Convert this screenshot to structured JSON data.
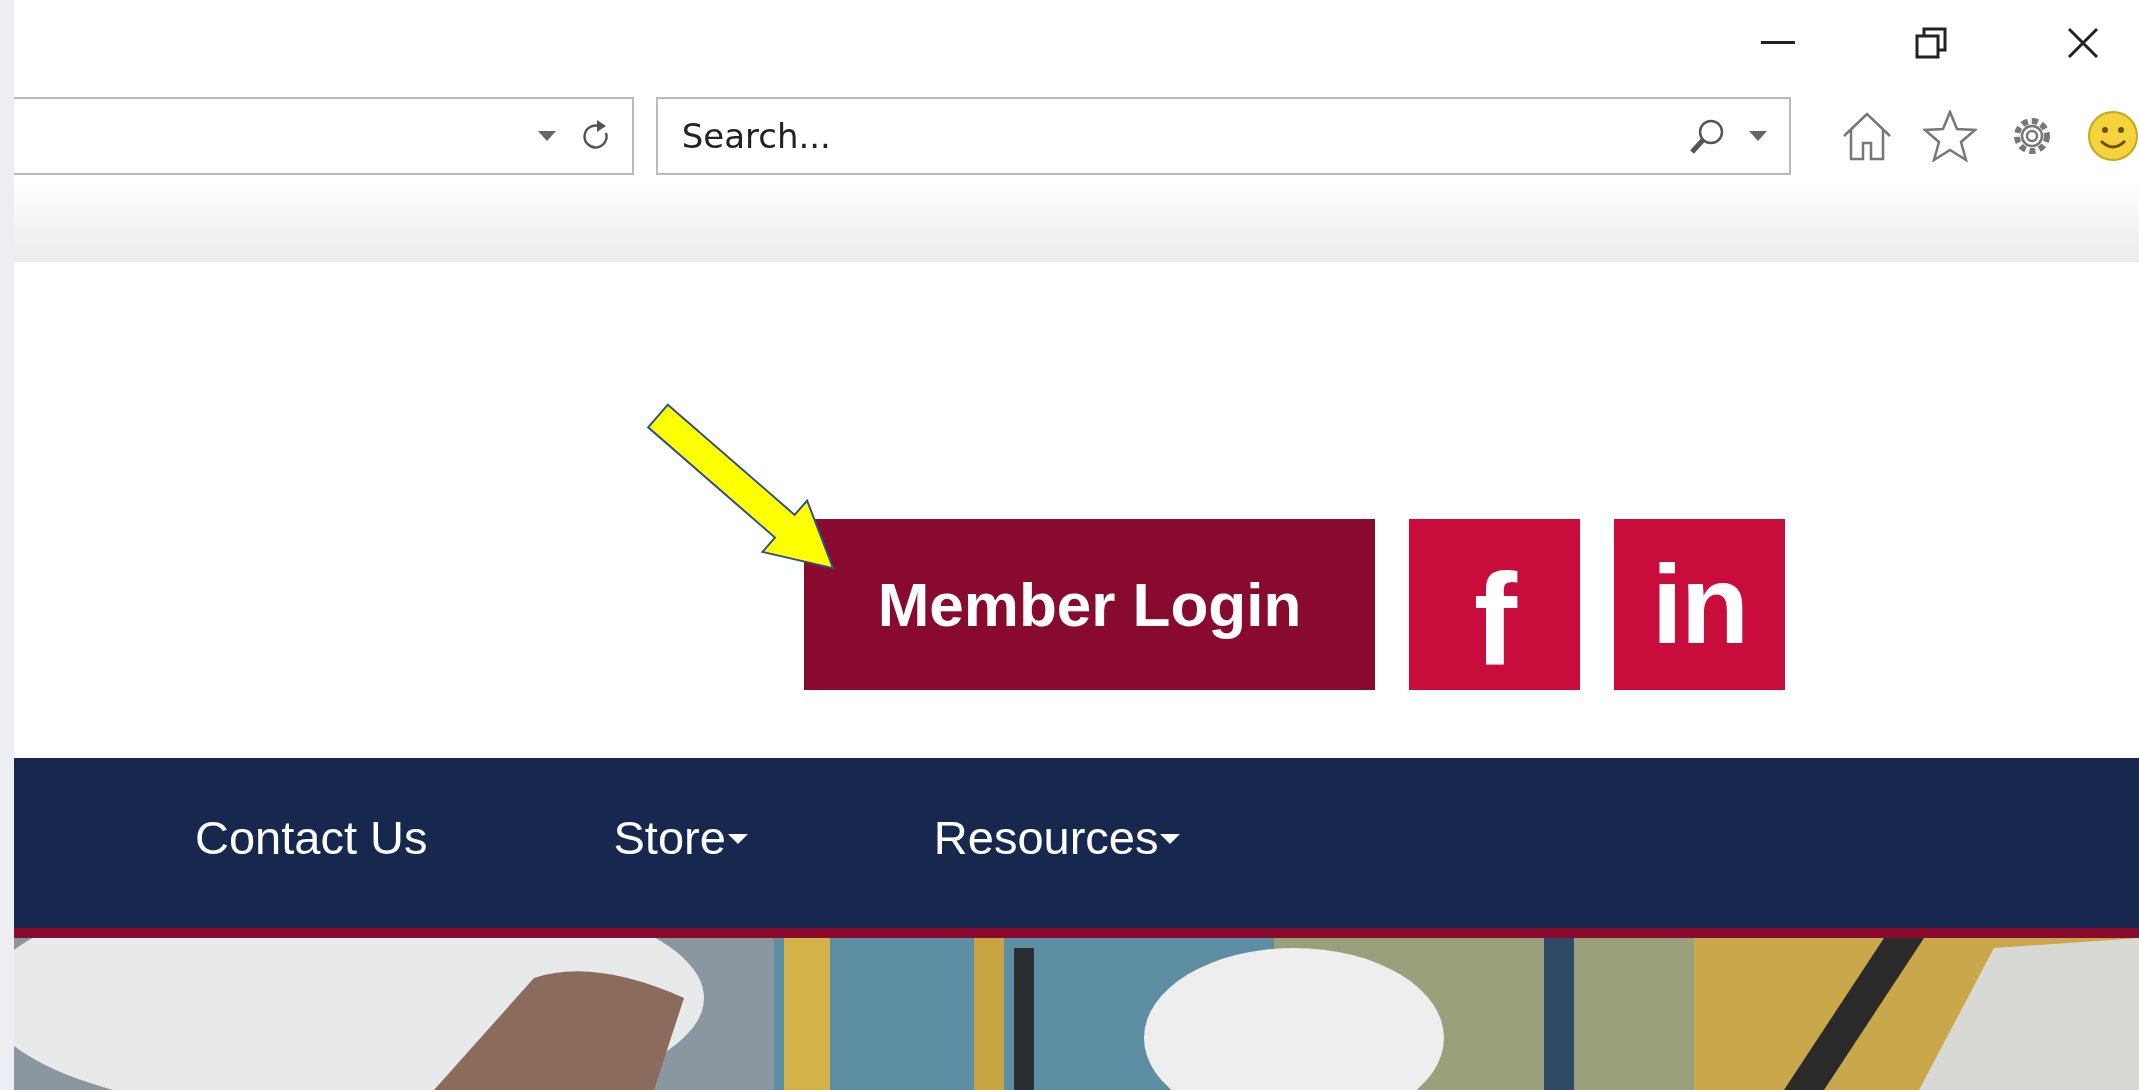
{
  "toolbar": {
    "search": {
      "placeholder": "Search..."
    }
  },
  "header": {
    "login_button": "Member Login",
    "social": [
      {
        "kind": "facebook",
        "label": "f"
      },
      {
        "kind": "linkedin",
        "label": "in"
      }
    ]
  },
  "nav": {
    "items": [
      {
        "label": "Contact Us",
        "dropdown": false
      },
      {
        "label": "Store",
        "dropdown": true
      },
      {
        "label": "Resources",
        "dropdown": true
      }
    ]
  }
}
